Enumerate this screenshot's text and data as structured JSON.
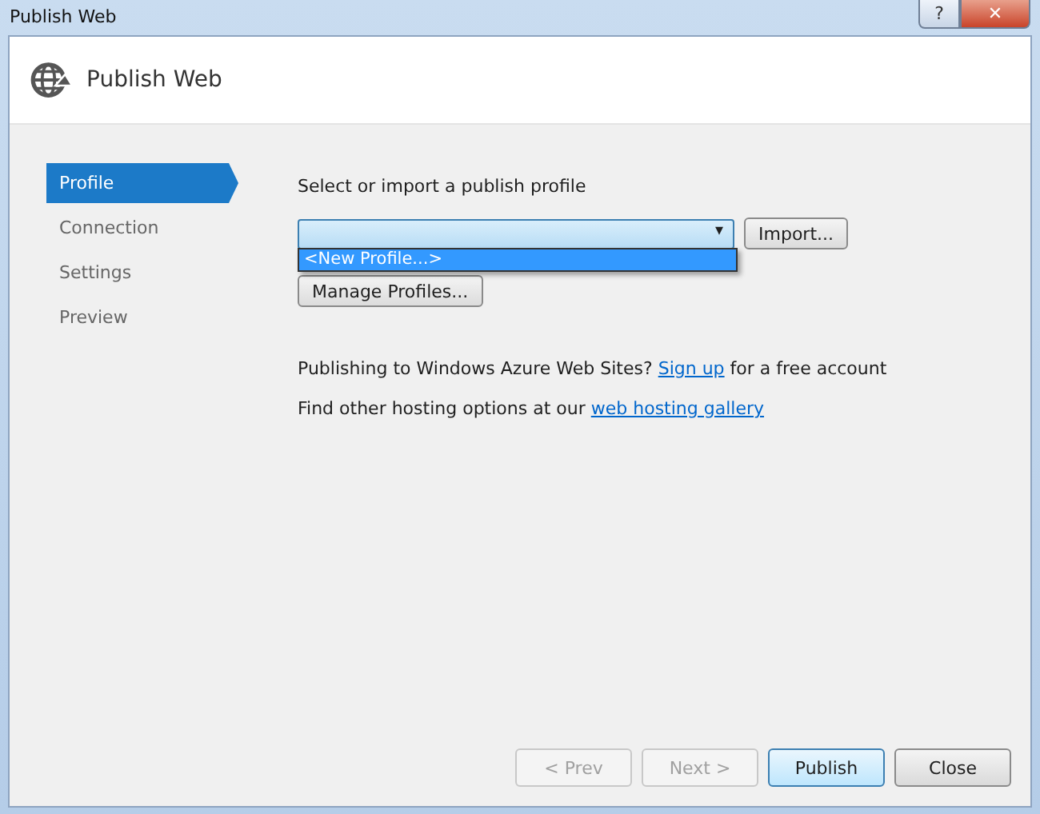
{
  "window": {
    "title": "Publish Web",
    "help_button": "?",
    "close_button": "✕"
  },
  "header": {
    "title": "Publish Web"
  },
  "steps": [
    {
      "label": "Profile",
      "selected": true
    },
    {
      "label": "Connection",
      "selected": false
    },
    {
      "label": "Settings",
      "selected": false
    },
    {
      "label": "Preview",
      "selected": false
    }
  ],
  "profile": {
    "prompt": "Select or import a publish profile",
    "combo_arrow": "▾",
    "dropdown_open": true,
    "options": [
      {
        "label": "<New Profile...>",
        "selected": true
      }
    ],
    "import_button": "Import...",
    "manage_button": "Manage Profiles..."
  },
  "info": [
    {
      "before": "Publishing to Windows Azure Web Sites? ",
      "link": "Sign up",
      "after": " for a free account"
    },
    {
      "before": "Find other hosting options at our ",
      "link": "web hosting gallery"
    }
  ],
  "buttons": [
    {
      "label": "< Prev",
      "disabled": true,
      "default": false
    },
    {
      "label": "Next >",
      "disabled": true,
      "default": false
    },
    {
      "label": "Publish",
      "disabled": false,
      "default": true
    },
    {
      "label": "Close",
      "disabled": false,
      "default": false
    }
  ]
}
